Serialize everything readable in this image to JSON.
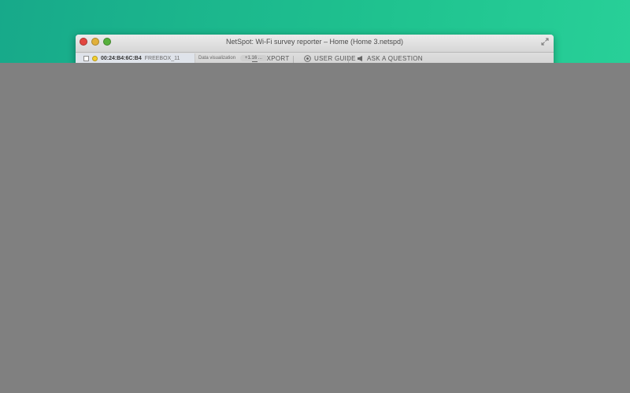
{
  "window": {
    "title": "NetSpot: Wi-Fi survey reporter – Home (Home 3.netspd)"
  },
  "toolbar": {
    "export_label": "EXPORT",
    "user_guide_label": "USER GUIDE",
    "ask_label": "ASK A QUESTION"
  },
  "sidebar": {
    "row": {
      "mac": "00:24:B4:6C:B4",
      "ssid": "FREEBOX_11"
    }
  },
  "filter": {
    "label": "Data visualization",
    "pill": "+1.16 ..."
  },
  "colors": {
    "desktop_start": "#17a98a",
    "desktop_end": "#2ad39a",
    "overlay": "#808080"
  }
}
